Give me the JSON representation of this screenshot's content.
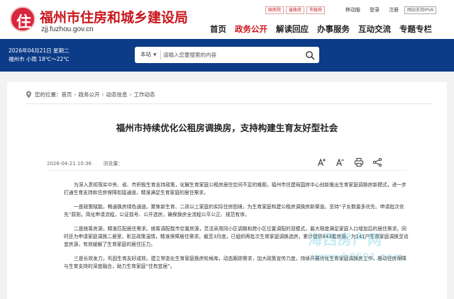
{
  "header": {
    "logo_glyph": "住",
    "site_title": "福州市住房和城乡建设局",
    "site_url": "zjj.fuzhou.gov.cn",
    "top_links": [
      "国务院",
      "省政府",
      "市政府"
    ],
    "mobile": "移动版",
    "login": "登录",
    "register": "注册",
    "ipv6": "网站支持IPV6",
    "nav": [
      {
        "label": "首页",
        "active": false
      },
      {
        "label": "政务公开",
        "active": true
      },
      {
        "label": "解读回应",
        "active": false
      },
      {
        "label": "办事服务",
        "active": false
      },
      {
        "label": "互动交流",
        "active": false
      },
      {
        "label": "专题专栏",
        "active": false
      }
    ]
  },
  "band": {
    "date": "2026年04月21日 星期二",
    "weather": "福州市 小雨 18℃～22℃",
    "search_scope": "本站",
    "search_placeholder": "请输入您要搜索的内容"
  },
  "breadcrumb": {
    "label": "您的位置：",
    "items": [
      "首页",
      "政务公开",
      "动态信息",
      "工作动态"
    ]
  },
  "article": {
    "title": "福州市持续优化公租房调换房，支持构建生育友好型社会",
    "date": "2026-04-21 10:36",
    "views": "浏览量：",
    "paragraphs": [
      "为深入贯彻落实中央、省、市积极生育支持政策，化解生育家庭公租房居住空间不足的难题，福州市住建局国房中心创新推出生育家庭调换房新模式，进一步打通生育支持和住房保障衔接通道，精准满足生育家庭的居住需求。",
      "一是政策赋能，畅通换房绿色通道。聚焦新生育、二孩以上家庭的实际住房困境，为生育家庭构建公租房调换房新渠道。坚持“子女数量多优先、申请批次优先”原则，简化申请流程，公证摇号、公开选房，确保换房全流程公平公正、规范有序。",
      "二是统筹房源，精准匹配居住需求。统筹调配我市空置房源，灵活采用同小区调换和跨小区位置调配的双模式，最大限度满足家庭人口增加后的居住需求。同时还为申请家庭调换二居室，彰显政策温情，精准保障居住需求。截至3月底，已组织两批次生育家庭调换选房，累计提供843套房源，为141户生育家庭调换至适宜房源，有效缓解了生育家庭的居住压力。",
      "三是长效发力，巩固生育友好成效。建立常态化生育家庭换房轮候库，动态跟踪需求，加大政策宣传力度，持续开展优化生育家庭调换房工作，推动住房保障与生育支持的深度融合，助力生育家庭“住有宜居”。"
    ]
  },
  "watermark": {
    "text": "海西房产网",
    "url": "www.h0591.com"
  },
  "colors": {
    "brand_red": "#c8161d",
    "band_blue": "#0c3b88"
  }
}
